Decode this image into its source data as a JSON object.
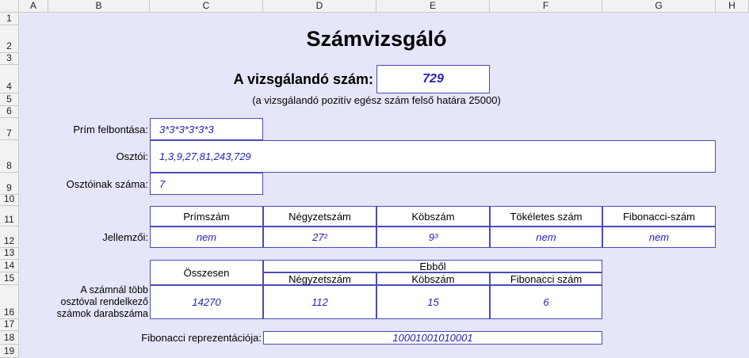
{
  "columns": [
    "A",
    "B",
    "C",
    "D",
    "E",
    "F",
    "G",
    "H"
  ],
  "rows": [
    "1",
    "2",
    "3",
    "4",
    "5",
    "6",
    "7",
    "8",
    "9",
    "10",
    "11",
    "12",
    "13",
    "14",
    "15",
    "16",
    "17",
    "18",
    "19"
  ],
  "title": "Számvizsgáló",
  "input": {
    "label": "A vizsgálandó szám:",
    "value": "729",
    "note": "(a vizsgálandó pozitív egész szám felső határa 25000)"
  },
  "factorization": {
    "label": "Prím felbontása:",
    "value": "3*3*3*3*3*3"
  },
  "divisors": {
    "label": "Osztói:",
    "value": "1,3,9,27,81,243,729"
  },
  "divisor_count": {
    "label": "Osztóinak száma:",
    "value": "7"
  },
  "properties": {
    "label": "Jellemzői:",
    "headers": [
      "Prímszám",
      "Négyzetszám",
      "Köbszám",
      "Tökéletes szám",
      "Fibonacci-szám"
    ],
    "values": [
      "nem",
      "27²",
      "9³",
      "nem",
      "nem"
    ]
  },
  "more_divisors": {
    "label": "A számnál több osztóval rendelkező számok darabszáma",
    "total_header": "Összesen",
    "group_header": "Ebből",
    "sub_headers": [
      "Négyzetszám",
      "Köbszám",
      "Fibonacci szám"
    ],
    "total_value": "14270",
    "sub_values": [
      "112",
      "15",
      "6"
    ]
  },
  "fibonacci": {
    "label": "Fibonacci reprezentációja:",
    "value": "10001001010001"
  }
}
